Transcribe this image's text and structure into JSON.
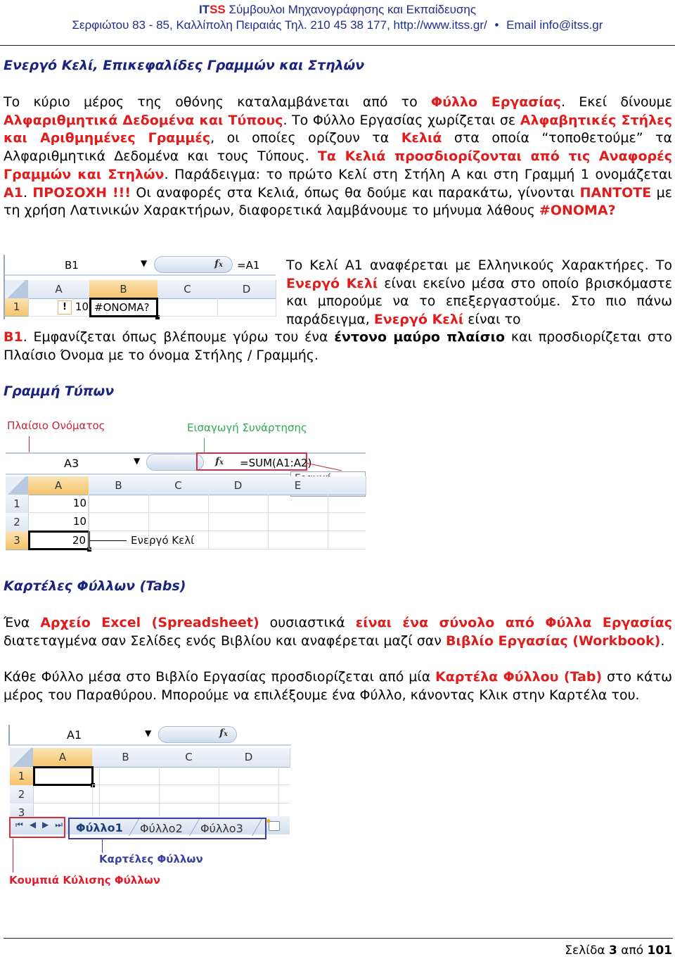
{
  "header": {
    "brand_i": "IT",
    "brand_ss": "SS",
    "title_rest": " Σύμβουλοι Μηχανογράφησης και Εκπαίδευσης",
    "address": "Σερφιώτου 83 - 85, Καλλίπολη Πειραιάς Τηλ. 210 45 38 177, http://www.itss.gr/",
    "bullet": "•",
    "email_label": "Email",
    "email": "info@itss.gr"
  },
  "section1": {
    "heading": "Ενεργό Κελί, Επικεφαλίδες Γραμμών και Στηλών",
    "p1": [
      {
        "t": "Το κύριο μέρος της οθόνης καταλαμβάνεται από το ",
        "s": ""
      },
      {
        "t": "Φύλλο Εργασίας",
        "s": "r"
      },
      {
        "t": ". Εκεί δίνουμε ",
        "s": ""
      },
      {
        "t": "Αλφαριθμητικά Δεδομένα και Τύπους",
        "s": "r"
      },
      {
        "t": ". Το Φύλλο Εργασίας χωρίζεται σε ",
        "s": ""
      },
      {
        "t": "Αλφαβητικές Στήλες και Αριθμημένες Γραμμές",
        "s": "r"
      },
      {
        "t": ", οι οποίες ορίζουν τα ",
        "s": ""
      },
      {
        "t": "Κελιά",
        "s": "r"
      },
      {
        "t": " στα οποία “τοποθετούμε” τα Αλφαριθμητικά Δεδομένα και τους Τύπους. ",
        "s": ""
      },
      {
        "t": "Τα Κελιά προσδιορίζονται από τις Αναφορές Γραμμών και Στηλών",
        "s": "r"
      },
      {
        "t": ". Παράδειγμα: το πρώτο Κελί στη Στήλη Α και στη Γραμμή 1 ονομάζεται ",
        "s": ""
      },
      {
        "t": "Α1",
        "s": "r"
      },
      {
        "t": ". ",
        "s": ""
      },
      {
        "t": "ΠΡΟΣΟΧΗ !!!",
        "s": "r"
      },
      {
        "t": " Οι αναφορές στα Κελιά, όπως θα δούμε και παρακάτω, γίνονται ",
        "s": ""
      },
      {
        "t": "ΠΑΝΤΟΤΕ",
        "s": "r"
      },
      {
        "t": " με τη χρήση Λατινικών Χαρακτήρων, διαφορετικά λαμβάνουμε το μήνυμα λάθους ",
        "s": ""
      },
      {
        "t": "#ΟΝΟΜΑ?",
        "s": "r"
      }
    ],
    "p2": [
      {
        "t": "Το Κελί Α1 αναφέρεται με Ελληνικούς Χαρακτήρες. Το ",
        "s": ""
      },
      {
        "t": "Ενεργό Κελί",
        "s": "r"
      },
      {
        "t": " είναι εκείνο μέσα στο οποίο βρισκόμαστε και μπορούμε να το επεξεργαστούμε. Στο πιο πάνω παράδειγμα, ",
        "s": ""
      },
      {
        "t": "Ενεργό Κελί",
        "s": "r"
      },
      {
        "t": " είναι το ",
        "s": ""
      }
    ],
    "p3": [
      {
        "t": "Β1",
        "s": "r"
      },
      {
        "t": ". Εμφανίζεται όπως βλέπουμε γύρω του ένα ",
        "s": ""
      },
      {
        "t": "έντονο μαύρο πλαίσιο",
        "s": "b"
      },
      {
        "t": " και προσδιορίζεται στο Πλαίσιο Όνομα με το όνομα Στήλης / Γραμμής.",
        "s": ""
      }
    ],
    "excel": {
      "name_box": "B1",
      "fx": "fx",
      "formula": "=A1",
      "columns": [
        "A",
        "B",
        "C",
        "D"
      ],
      "rows": [
        "1"
      ],
      "cell_a1": "10",
      "cell_b1": "#ONOMA?",
      "warning_icon": "!"
    }
  },
  "section2": {
    "heading": "Γραμμή Τύπων",
    "annotations": {
      "name_box": "Πλαίσιο Ονόματος",
      "insert_function": "Εισαγωγή Συνάρτησης",
      "formula_bar": "Γραμμή τύπων",
      "active_cell": "Ενεργό Κελί"
    },
    "annotation_colors": {
      "name_box": "#c0283a",
      "insert_function": "#2eaa4f",
      "formula_bar": "#c0283a"
    },
    "excel": {
      "name_box": "A3",
      "fx": "fx",
      "formula": "=SUM(A1:A2)",
      "columns": [
        "A",
        "B",
        "C",
        "D",
        "E"
      ],
      "rows": [
        "1",
        "2",
        "3"
      ],
      "values": [
        "10",
        "10",
        "20"
      ]
    }
  },
  "section3": {
    "heading": "Καρτέλες Φύλλων (Tabs)",
    "p1": [
      {
        "t": "Ένα ",
        "s": ""
      },
      {
        "t": "Αρχείο Excel (Spreadsheet)",
        "s": "r"
      },
      {
        "t": " ουσιαστικά ",
        "s": ""
      },
      {
        "t": "είναι ένα σύνολο από Φύλλα Εργασίας",
        "s": "r"
      },
      {
        "t": " διατεταγμένα σαν Σελίδες ενός Βιβλίου και αναφέρεται μαζί σαν ",
        "s": ""
      },
      {
        "t": "Βιβλίο Εργασίας (Workbook)",
        "s": "r"
      },
      {
        "t": ".",
        "s": ""
      }
    ],
    "p2": [
      {
        "t": "Κάθε Φύλλο μέσα στο Βιβλίο Εργασίας προσδιορίζεται από μία ",
        "s": ""
      },
      {
        "t": "Καρτέλα Φύλλου (Tab)",
        "s": "r"
      },
      {
        "t": " στο κάτω μέρος του Παραθύρου. Μπορούμε να επιλέξουμε ένα Φύλλο, κάνοντας Κλικ στην Καρτέλα του.",
        "s": ""
      }
    ],
    "excel": {
      "name_box": "A1",
      "fx": "fx",
      "columns": [
        "A",
        "B",
        "C",
        "D"
      ],
      "rows": [
        "1",
        "2",
        "3"
      ],
      "tabs": [
        "Φύλλο1",
        "Φύλλο2",
        "Φύλλο3"
      ],
      "active_tab": "Φύλλο1",
      "scroll_buttons": [
        "first",
        "prev",
        "next",
        "last"
      ]
    },
    "annotations": {
      "sheet_tabs": "Καρτέλες Φύλλων",
      "scroll_buttons": "Κουμπιά Κύλισης Φύλλων"
    },
    "annotation_colors": {
      "sheet_tabs": "#3b3f9e",
      "scroll_buttons": "#e01c2c"
    }
  },
  "footer": {
    "page_label": "Σελίδα",
    "page": "3",
    "of_label": "από",
    "total": "101"
  }
}
